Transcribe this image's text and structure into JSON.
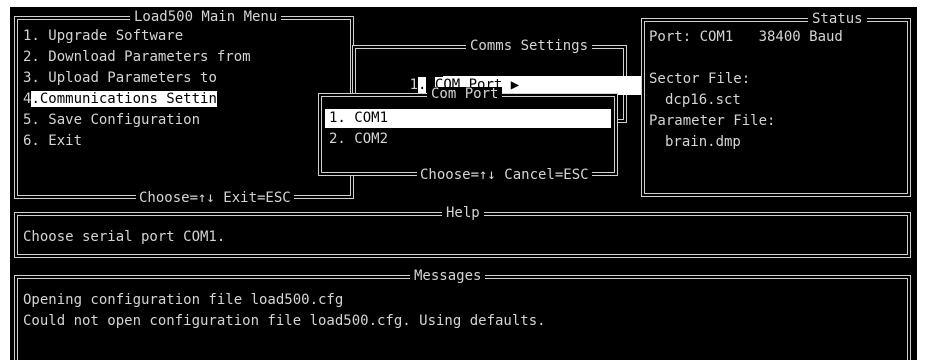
{
  "main_menu": {
    "title": "Load500 Main Menu",
    "items": [
      {
        "num": "1.",
        "label": "Upgrade Software"
      },
      {
        "num": "2.",
        "label": "Download Parameters from"
      },
      {
        "num": "3.",
        "label": "Upload Parameters to"
      },
      {
        "num": "4",
        "label": "Communications Settin"
      },
      {
        "num": "5.",
        "label": "Save Configuration"
      },
      {
        "num": "6.",
        "label": "Exit"
      }
    ],
    "footer": "Choose=↑↓ Exit=ESC"
  },
  "comms_settings": {
    "title": "Comms Settings",
    "item_num": "1",
    "item_first_letter": "C",
    "item_rest": "OM Port",
    "arrow": "▶"
  },
  "com_port": {
    "title": "Com Port",
    "items": [
      {
        "num": "1.",
        "label": "COM1"
      },
      {
        "num": "2.",
        "label": "COM2"
      }
    ],
    "footer": "Choose=↑↓ Cancel=ESC"
  },
  "status": {
    "title": "Status",
    "port_line": "Port: COM1   38400 Baud",
    "sector_label": "Sector File:",
    "sector_value": "dcp16.sct",
    "param_label": "Parameter File:",
    "param_value": "brain.dmp"
  },
  "help": {
    "title": "Help",
    "text": "Choose serial port COM1."
  },
  "messages": {
    "title": "Messages",
    "lines": [
      "Opening configuration file load500.cfg",
      "Could not open configuration file load500.cfg. Using defaults."
    ]
  }
}
